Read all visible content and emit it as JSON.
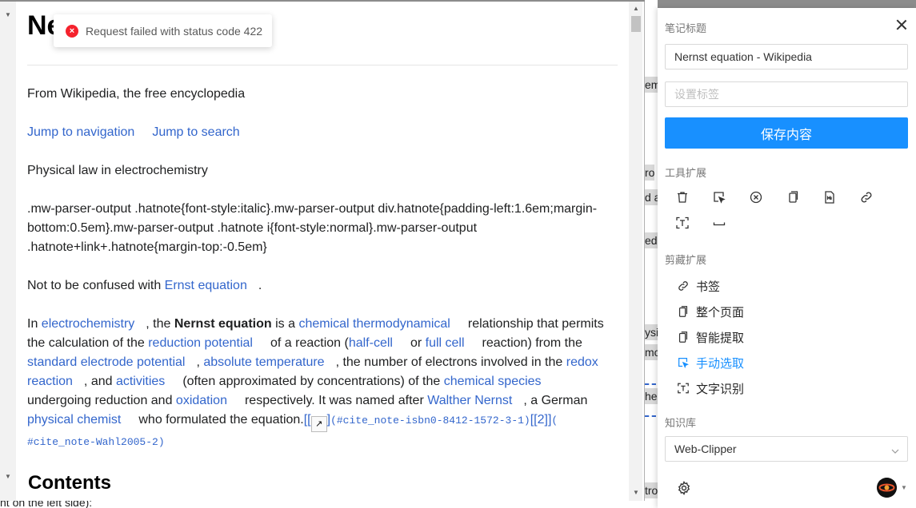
{
  "background": {
    "fragments": [
      "em",
      "ro",
      "d a",
      "ed",
      "ysi",
      "mc",
      "he",
      "tro"
    ],
    "bottom_text": "nt on the left side):"
  },
  "preview": {
    "title": "Ne",
    "p1": "From Wikipedia, the free encyclopedia",
    "nav_link": "Jump to navigation",
    "search_link": "Jump to search",
    "p3": "Physical law in electrochemistry",
    "css_line1": ".mw-parser-output .hatnote{font-style:italic}.mw-parser-output div.hatnote{padding-left:1.6em;margin-",
    "css_line2": "bottom:0.5em}.mw-parser-output .hatnote i{font-style:normal}.mw-parser-output",
    "css_line3": ".hatnote+link+.hatnote{margin-top:-0.5em}",
    "confused_prefix": "Not to be confused with ",
    "confused_link": "Ernst equation",
    "confused_suffix": ".",
    "intro": {
      "t1": "In ",
      "l_electrochemistry": "electrochemistry",
      "t2": ", the ",
      "bold": "Nernst equation",
      "t3": " is a ",
      "l_chem_thermo": "chemical thermodynamical",
      "t4": "relationship that permits",
      "t5": "the calculation of the ",
      "l_reduction": "reduction potential",
      "t6": "of a reaction (",
      "l_half_cell": "half-cell",
      "t7": "or ",
      "l_full_cell": "full cell",
      "t8": "reaction) from the",
      "l_standard": "standard electrode potential",
      "t9": ", ",
      "l_abs_temp": "absolute temperature",
      "t10": ", the number of electrons involved in the ",
      "l_redox_a": "redox",
      "l_redox_b": "reaction",
      "t11": ", and ",
      "l_activities": "activities",
      "t12": "(often approximated by concentrations) of the ",
      "l_species": "chemical species",
      "t13": "undergoing reduction and ",
      "l_oxidation": "oxidation",
      "t14": "respectively. It was named after ",
      "l_walther": "Walther Nernst",
      "t15": ", a German",
      "l_phys_chem": "physical chemist",
      "t16": "who formulated the equation.",
      "cite1_open": "[[",
      "cite1_num": "1",
      "cite1_close": "]",
      "cite1_ref": "(#cite_note-isbn0-8412-1572-3-1)",
      "cite2": "[[2]]",
      "cite2_ref_open": "(",
      "cite2_ref": "#cite_note-Wahl2005-2)"
    },
    "contents_heading": "Contents"
  },
  "toast": {
    "message": "Request failed with status code 422",
    "icon": "error-circle-icon"
  },
  "clipper": {
    "title_label": "笔记标题",
    "title_value": "Nernst equation - Wikipedia",
    "tags_placeholder": "设置标签",
    "save_label": "保存内容",
    "tools_label": "工具扩展",
    "tools": [
      "trash-icon",
      "select-area-icon",
      "clear-circle-icon",
      "copy-icon",
      "markdown-file-icon",
      "link-icon",
      "ocr-text-icon",
      "space-icon"
    ],
    "clip_label": "剪藏扩展",
    "clip_items": [
      {
        "label": "书签",
        "icon": "link-icon"
      },
      {
        "label": "整个页面",
        "icon": "page-icon"
      },
      {
        "label": "智能提取",
        "icon": "page-icon"
      },
      {
        "label": "手动选取",
        "icon": "select-area-icon",
        "active": true
      },
      {
        "label": "文字识别",
        "icon": "ocr-text-icon"
      }
    ],
    "kb_label": "知识库",
    "kb_value": "Web-Clipper",
    "accent": "#1890ff"
  }
}
